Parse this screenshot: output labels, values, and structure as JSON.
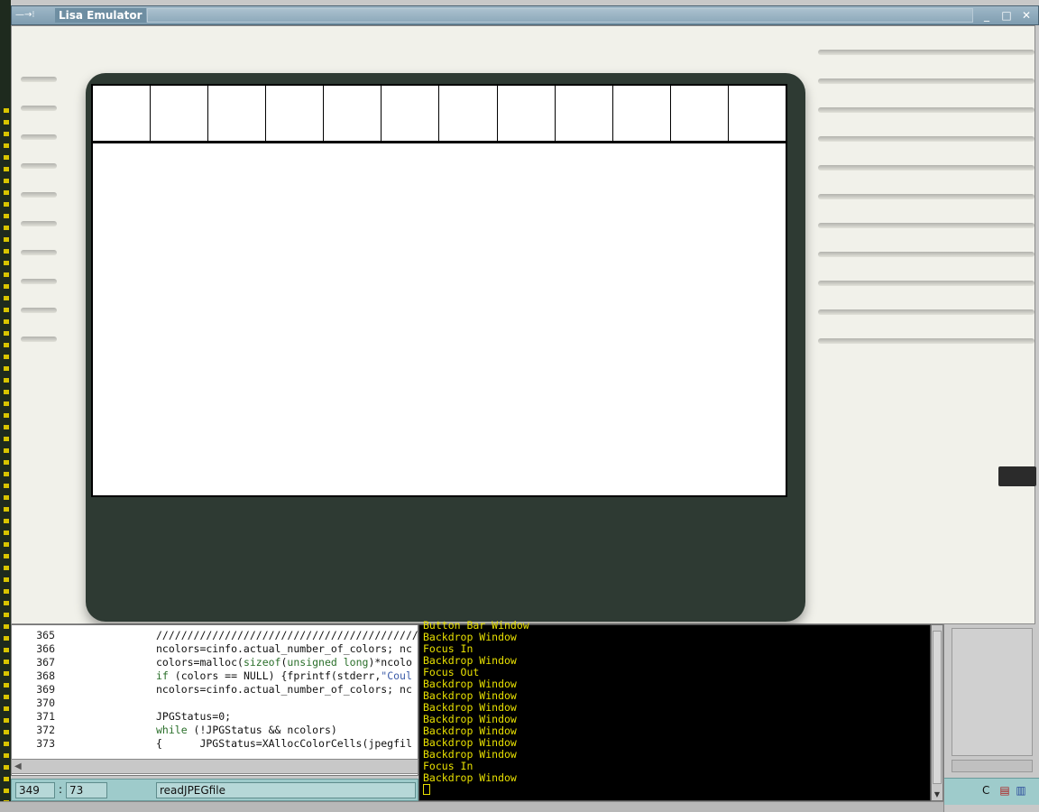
{
  "window": {
    "title": "Lisa Emulator",
    "grip_glyph": "—→⁝",
    "minimize_glyph": "_",
    "maximize_glyph": "□",
    "close_glyph": "✕"
  },
  "editor": {
    "lines": [
      {
        "num": "365",
        "code": "////////////////////////////////////////////"
      },
      {
        "num": "366",
        "code": "ncolors=cinfo.actual_number_of_colors; nc"
      },
      {
        "num": "367",
        "code": "colors=malloc(sizeof(unsigned long)*ncolo"
      },
      {
        "num": "368",
        "code": "if (colors == NULL) {fprintf(stderr,\"Coul"
      },
      {
        "num": "369",
        "code": "ncolors=cinfo.actual_number_of_colors; nc"
      },
      {
        "num": "370",
        "code": ""
      },
      {
        "num": "371",
        "code": "JPGStatus=0;"
      },
      {
        "num": "372",
        "code": "while (!JPGStatus && ncolors)"
      },
      {
        "num": "373",
        "code": "{      JPGStatus=XAllocColorCells(jpegfil"
      }
    ]
  },
  "status_bar": {
    "line": "349",
    "separator": ":",
    "column": "73",
    "function": "readJPEGfile"
  },
  "terminal": {
    "lines": [
      "Button Bar Window",
      "Backdrop Window",
      "Focus In",
      "Backdrop Window",
      "Focus Out",
      "Backdrop Window",
      "Backdrop Window",
      "Backdrop Window",
      "Backdrop Window",
      "Backdrop Window",
      "Backdrop Window",
      "Backdrop Window",
      "Focus In",
      "Backdrop Window"
    ]
  },
  "tray": {
    "label": "C",
    "icons": [
      "document-icon",
      "clipboard-icon"
    ]
  },
  "colors": {
    "terminal_text": "#e8e000",
    "status_bar": "#9ecbcb",
    "title_bar": "#7f9db0"
  }
}
